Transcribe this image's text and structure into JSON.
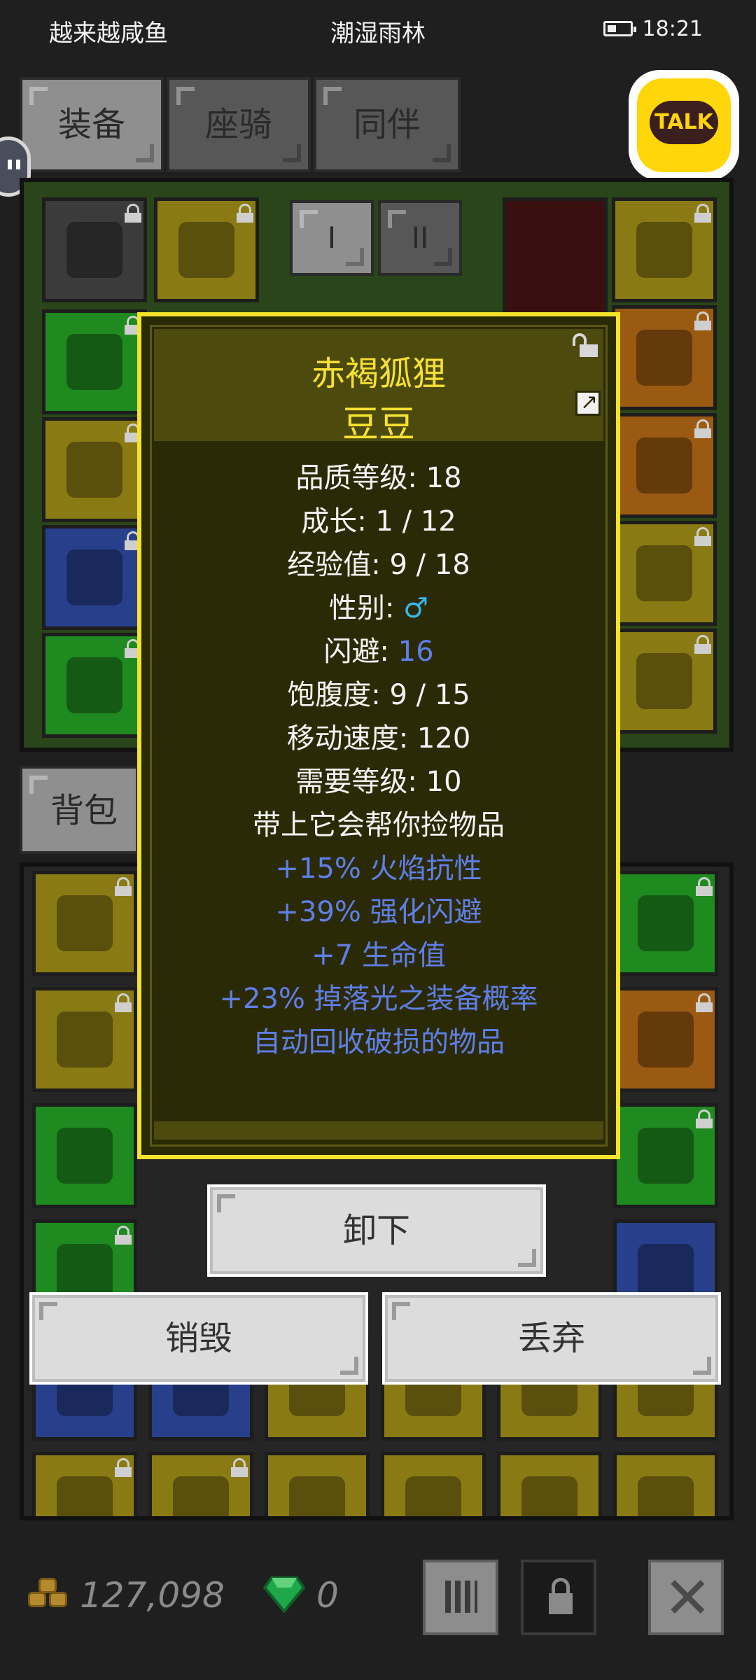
{
  "status_bar": {
    "left_text": "越来越咸鱼",
    "location": "潮湿雨林",
    "time": "18:21"
  },
  "tabs": [
    {
      "label": "装备"
    },
    {
      "label": "座骑"
    },
    {
      "label": "同伴"
    }
  ],
  "talk_button": {
    "label": "TALK"
  },
  "equip_subtabs": [
    {
      "label": "I"
    },
    {
      "label": "II"
    }
  ],
  "bag_tab": {
    "label": "背包 ("
  },
  "popup": {
    "pet_name": "赤褐狐狸",
    "pet_nickname": "豆豆",
    "stats": [
      {
        "label": "品质等级: ",
        "value": "18"
      },
      {
        "label": "成长: ",
        "value": "1 / 12"
      },
      {
        "label": "经验值: ",
        "value": "9 / 18"
      },
      {
        "label": "性别: ",
        "value": "♂"
      },
      {
        "label": "闪避: ",
        "value": "16"
      },
      {
        "label": "饱腹度: ",
        "value": "9 / 15"
      },
      {
        "label": "移动速度: ",
        "value": "120"
      },
      {
        "label": "需要等级: ",
        "value": "10"
      }
    ],
    "description": "带上它会帮你捡物品",
    "bonuses": [
      "+15% 火焰抗性",
      "+39% 强化闪避",
      "+7 生命值",
      "+23% 掉落光之装备概率",
      "自动回收破损的物品"
    ]
  },
  "buttons": {
    "unequip": "卸下",
    "destroy": "销毁",
    "discard": "丢弃"
  },
  "currency": {
    "gold": "127,098",
    "gems": "0"
  },
  "colors": {
    "popup_border": "#f3e42b",
    "title_yellow": "#f6e132",
    "bonus_blue": "#5f7fe8",
    "male_cyan": "#37b6e8"
  }
}
